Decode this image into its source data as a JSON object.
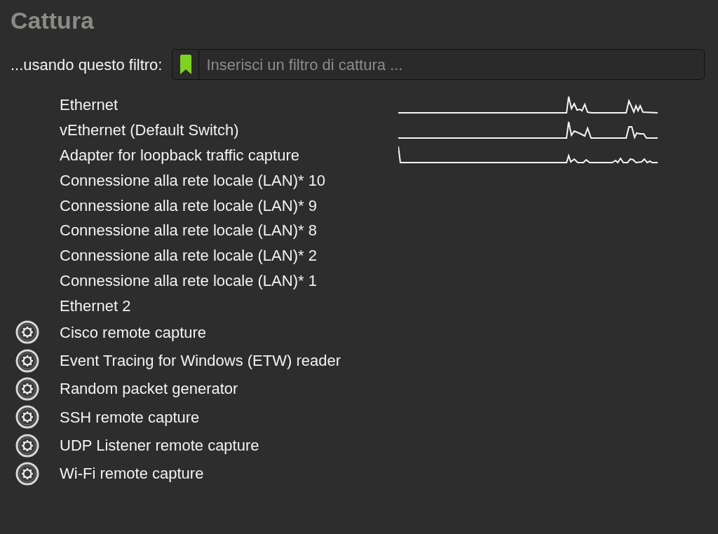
{
  "title": "Cattura",
  "filter": {
    "label": "...usando questo filtro:",
    "placeholder": "Inserisci un filtro di cattura ..."
  },
  "interfaces": [
    {
      "kind": "interface",
      "name": "Ethernet",
      "traffic": true
    },
    {
      "kind": "interface",
      "name": "vEthernet (Default Switch)",
      "traffic": true
    },
    {
      "kind": "interface",
      "name": "Adapter for loopback traffic capture",
      "traffic": true
    },
    {
      "kind": "interface",
      "name": "Connessione alla rete locale (LAN)* 10",
      "traffic": false
    },
    {
      "kind": "interface",
      "name": "Connessione alla rete locale (LAN)* 9",
      "traffic": false
    },
    {
      "kind": "interface",
      "name": "Connessione alla rete locale (LAN)* 8",
      "traffic": false
    },
    {
      "kind": "interface",
      "name": "Connessione alla rete locale (LAN)* 2",
      "traffic": false
    },
    {
      "kind": "interface",
      "name": "Connessione alla rete locale (LAN)* 1",
      "traffic": false
    },
    {
      "kind": "interface",
      "name": "Ethernet 2",
      "traffic": false
    },
    {
      "kind": "extcap",
      "name": "Cisco remote capture",
      "traffic": false
    },
    {
      "kind": "extcap",
      "name": "Event Tracing for Windows (ETW) reader",
      "traffic": false
    },
    {
      "kind": "extcap",
      "name": "Random packet generator",
      "traffic": false
    },
    {
      "kind": "extcap",
      "name": "SSH remote capture",
      "traffic": false
    },
    {
      "kind": "extcap",
      "name": "UDP Listener remote capture",
      "traffic": false
    },
    {
      "kind": "extcap",
      "name": "Wi-Fi remote capture",
      "traffic": false
    }
  ]
}
